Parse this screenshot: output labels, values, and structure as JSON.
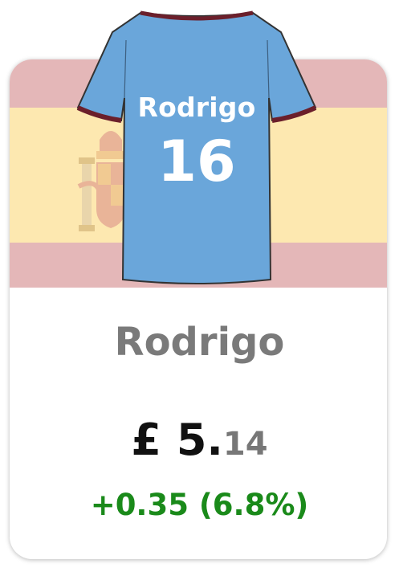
{
  "player": {
    "jersey_name": "Rodrigo",
    "jersey_number": "16",
    "name": "Rodrigo"
  },
  "price": {
    "currency": "£",
    "whole": "5.",
    "decimal": "14",
    "change": "+0.35 (6.8%)"
  },
  "flag": {
    "country": "Spain",
    "colors": {
      "red": "#e4b7b8",
      "yellow": "#fde8b0"
    }
  },
  "jersey": {
    "color": "#6aa6da",
    "trim_color": "#6b1f2b"
  },
  "colors": {
    "name_text": "#7a7a7a",
    "price_text": "#111111",
    "decimal_text": "#777777",
    "change_positive": "#1a8a1a"
  }
}
